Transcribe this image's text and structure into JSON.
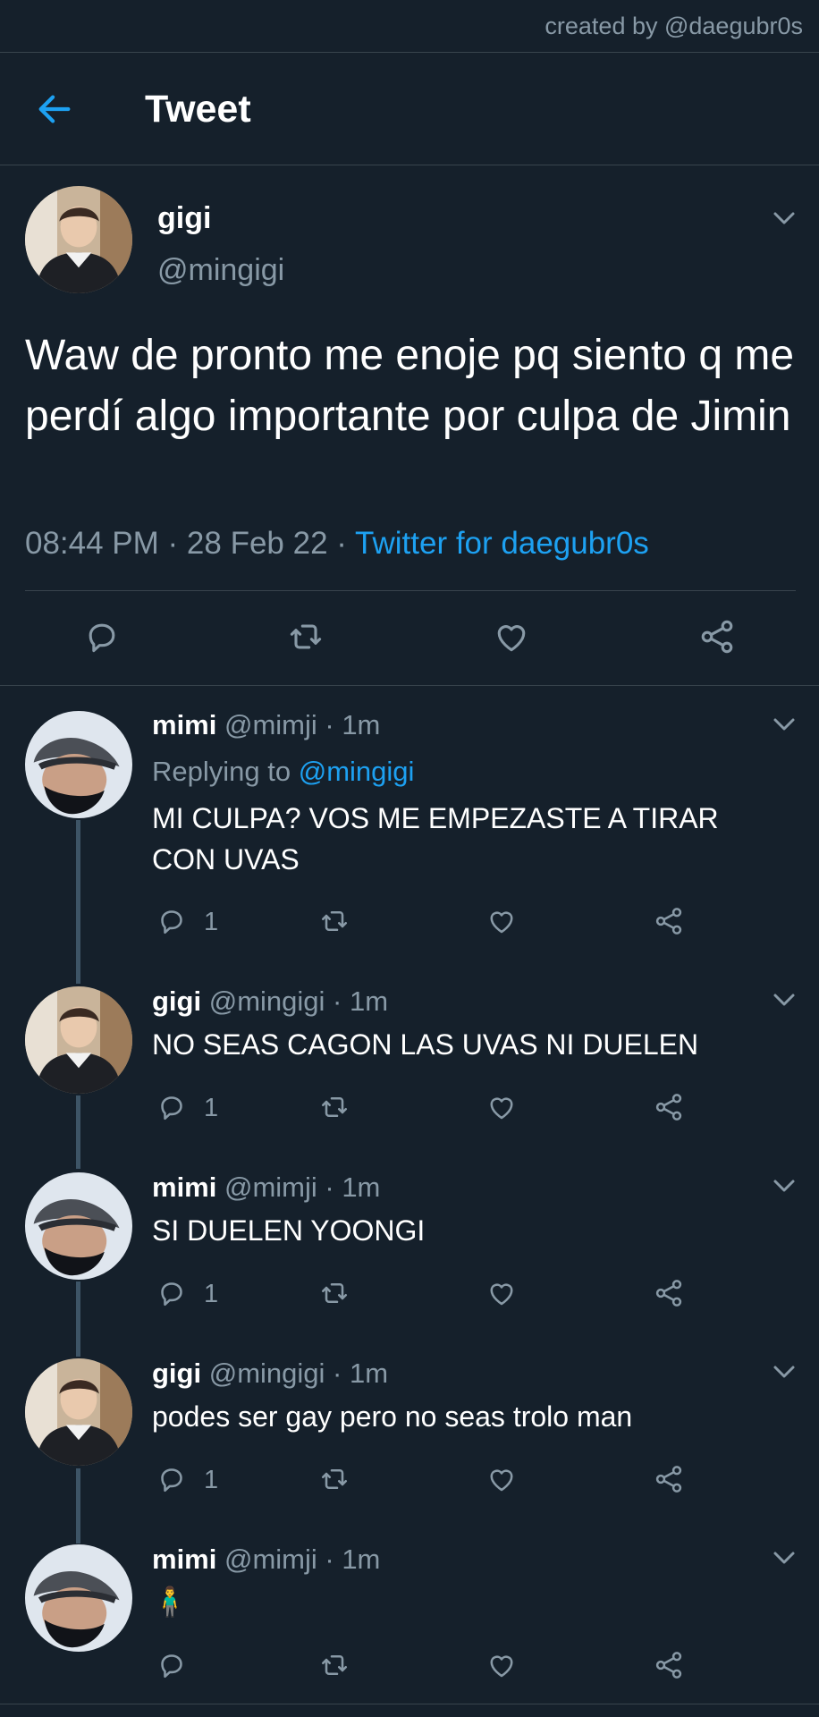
{
  "watermark": "created by @daegubr0s",
  "header": {
    "title": "Tweet"
  },
  "main_tweet": {
    "name": "gigi",
    "handle": "@mingigi",
    "text": "Waw de pronto me enoje pq siento q me perdí algo importante por culpa de Jimin",
    "time": "08:44 PM",
    "date": "28 Feb 22",
    "sep": " · ",
    "source": "Twitter for daegubr0s"
  },
  "replies": [
    {
      "name": "mimi",
      "handle": "@mimji",
      "time": " · 1m",
      "replying_label": "Replying to ",
      "replying_to": "@mingigi",
      "text": "MI CULPA? VOS ME EMPEZASTE A TIRAR CON UVAS",
      "reply_count": "1",
      "avatar": "mimi"
    },
    {
      "name": "gigi",
      "handle": "@mingigi",
      "time": " · 1m",
      "text": "NO SEAS CAGON LAS UVAS NI DUELEN",
      "reply_count": "1",
      "avatar": "gigi"
    },
    {
      "name": "mimi",
      "handle": "@mimji",
      "time": " · 1m",
      "text": "SI DUELEN YOONGI",
      "reply_count": "1",
      "avatar": "mimi"
    },
    {
      "name": "gigi",
      "handle": "@mingigi",
      "time": " · 1m",
      "text": "podes ser gay pero no seas trolo man",
      "reply_count": "1",
      "avatar": "gigi"
    },
    {
      "name": "mimi",
      "handle": "@mimji",
      "time": " · 1m",
      "text": "🧍‍♂️",
      "reply_count": "",
      "avatar": "mimi"
    }
  ],
  "colors": {
    "background": "#15202b",
    "accent": "#1da1f2",
    "muted": "#8899a6",
    "divider": "#38444d"
  },
  "icons": [
    "back-arrow-icon",
    "chevron-down-icon",
    "reply-icon",
    "retweet-icon",
    "like-icon",
    "share-icon"
  ]
}
